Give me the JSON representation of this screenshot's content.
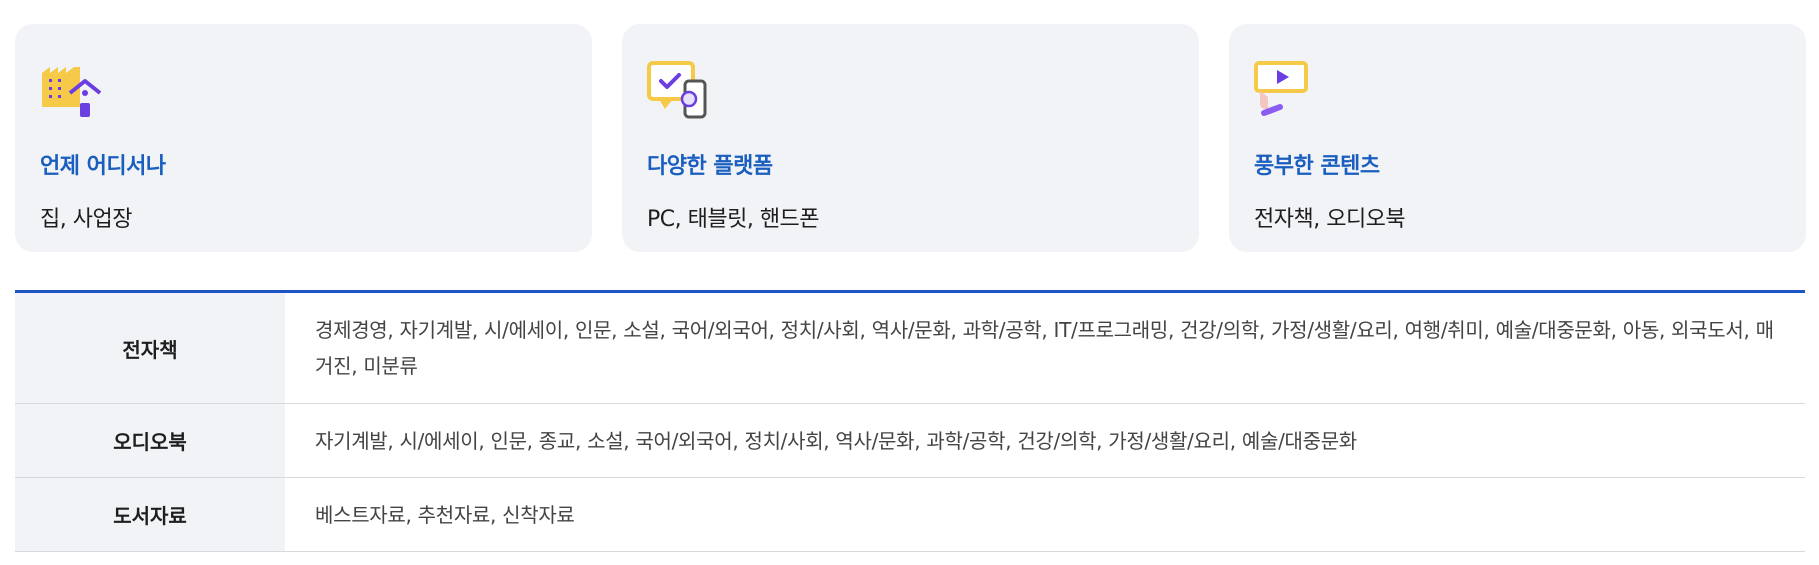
{
  "cards": [
    {
      "icon": "factory-home-icon",
      "title": "언제 어디서나",
      "desc": "집, 사업장"
    },
    {
      "icon": "monitor-mobile-icon",
      "title": "다양한 플랫폼",
      "desc": "PC, 태블릿, 핸드폰"
    },
    {
      "icon": "video-content-icon",
      "title": "풍부한 콘텐츠",
      "desc": "전자책, 오디오북"
    }
  ],
  "table": {
    "rows": [
      {
        "head": "전자책",
        "body": "경제경영, 자기계발, 시/에세이, 인문, 소설, 국어/외국어, 정치/사회, 역사/문화, 과학/공학, IT/프로그래밍, 건강/의학, 가정/생활/요리, 여행/취미, 예술/대중문화, 아동, 외국도서, 매거진, 미분류"
      },
      {
        "head": "오디오북",
        "body": "자기계발, 시/에세이, 인문, 종교, 소설, 국어/외국어, 정치/사회, 역사/문화, 과학/공학, 건강/의학, 가정/생활/요리, 예술/대중문화"
      },
      {
        "head": "도서자료",
        "body": "베스트자료, 추천자료, 신착자료"
      }
    ]
  },
  "colors": {
    "accent": "#1a5fbf",
    "table_border": "#1e55c4",
    "card_bg": "#f1f3f7",
    "icon_yellow": "#f7c948",
    "icon_purple": "#6a3ee0"
  }
}
